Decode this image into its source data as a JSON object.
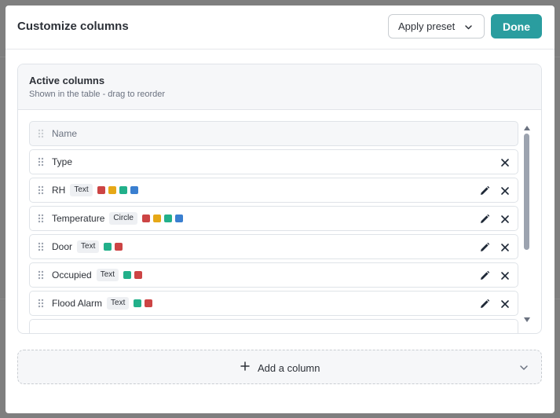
{
  "modal": {
    "title": "Customize columns",
    "preset_label": "Apply preset",
    "done_label": "Done"
  },
  "panel": {
    "title": "Active columns",
    "subtitle": "Shown in the table - drag to reorder"
  },
  "columns": [
    {
      "label": "Name",
      "locked": true,
      "badge": "",
      "colors": [],
      "editable": false,
      "removable": false
    },
    {
      "label": "Type",
      "locked": false,
      "badge": "",
      "colors": [],
      "editable": false,
      "removable": true
    },
    {
      "label": "RH",
      "locked": false,
      "badge": "Text",
      "colors": [
        "#cc4444",
        "#e6a817",
        "#22b08a",
        "#3a7fd0"
      ],
      "editable": true,
      "removable": true
    },
    {
      "label": "Temperature",
      "locked": false,
      "badge": "Circle",
      "colors": [
        "#cc4444",
        "#e6a817",
        "#22b08a",
        "#3a7fd0"
      ],
      "editable": true,
      "removable": true
    },
    {
      "label": "Door",
      "locked": false,
      "badge": "Text",
      "colors": [
        "#22b08a",
        "#cc4444"
      ],
      "editable": true,
      "removable": true
    },
    {
      "label": "Occupied",
      "locked": false,
      "badge": "Text",
      "colors": [
        "#22b08a",
        "#cc4444"
      ],
      "editable": true,
      "removable": true
    },
    {
      "label": "Flood Alarm",
      "locked": false,
      "badge": "Text",
      "colors": [
        "#22b08a",
        "#cc4444"
      ],
      "editable": true,
      "removable": true
    }
  ],
  "add_column": {
    "label": "Add a column"
  },
  "colors": {
    "accent": "#2a9d9f",
    "backdrop": "#7f7f7f"
  }
}
